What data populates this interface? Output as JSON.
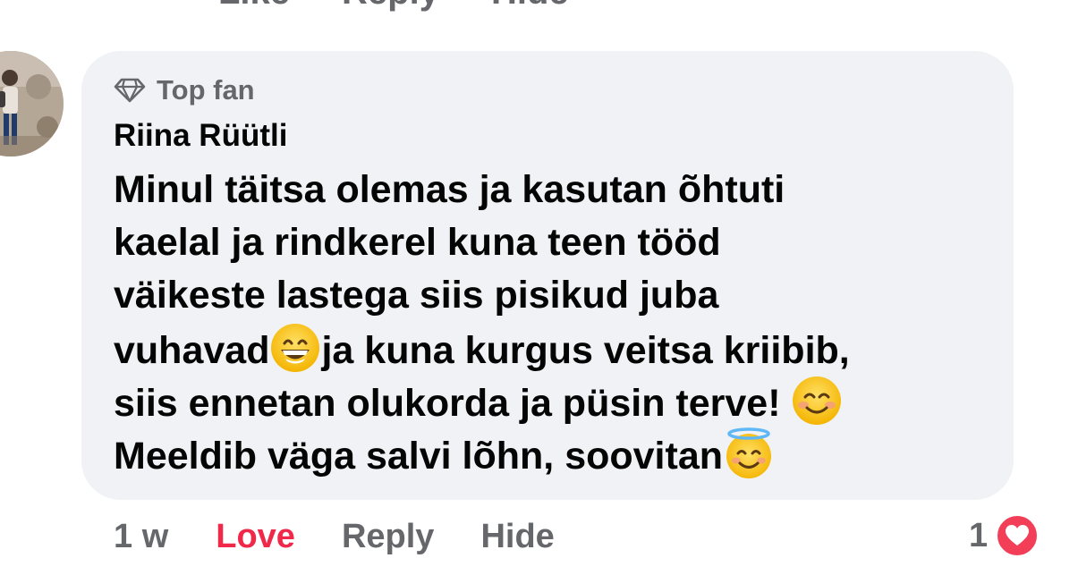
{
  "previous_comment": {
    "actions": [
      "Like",
      "Reply",
      "Hide"
    ]
  },
  "comment": {
    "badge_icon": "diamond-icon",
    "badge_label": "Top fan",
    "author": "Riina Rüütli",
    "lines": [
      "Minul täitsa olemas ja kasutan õhtuti",
      "kaelal ja rindkerel kuna teen tööd",
      "väikeste lastega siis pisikud juba",
      "vuhavad",
      "ja kuna kurgus veitsa kriibib,",
      "siis ennetan olukorda ja püsin terve!",
      "Meeldib väga salvi lõhn, soovitan"
    ],
    "emojis": [
      "grinning-face-emoji",
      "smiling-face-emoji",
      "halo-face-emoji"
    ]
  },
  "actions": {
    "time": "1 w",
    "love": "Love",
    "reply": "Reply",
    "hide": "Hide"
  },
  "reactions": {
    "count": "1",
    "icon": "heart-reaction-icon",
    "color": "#f33e58"
  },
  "colors": {
    "bubble": "#f0f2f5",
    "secondary_text": "#65676b",
    "love": "#f02849"
  }
}
